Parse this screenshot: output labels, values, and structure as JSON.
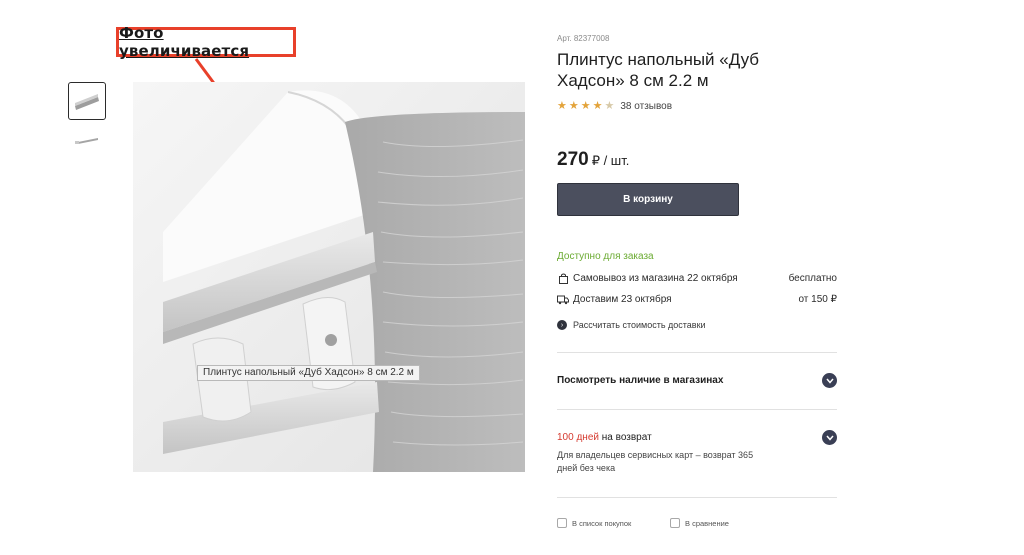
{
  "annotation": {
    "label": "Фото увеличивается",
    "color": "#e8402a"
  },
  "gallery": {
    "tooltip": "Плинтус напольный «Дуб Хадсон» 8 см 2.2 м"
  },
  "product": {
    "sku": "Арт. 82377008",
    "title": "Плинтус напольный «Дуб Хадсон» 8 см 2.2 м",
    "rating_value": 4.5,
    "reviews": "38 отзывов",
    "price": "270",
    "price_unit": "₽ / шт.",
    "cart_button": "В корзину"
  },
  "availability": {
    "status": "Доступно для заказа",
    "pickup": {
      "label": "Самовывоз из магазина 22 октября",
      "value": "бесплатно",
      "icon": "bag-icon"
    },
    "delivery": {
      "label": "Доставим 23 октября",
      "value": "от 150 ₽",
      "icon": "truck-icon"
    },
    "calc_link": "Рассчитать стоимость доставки"
  },
  "accordion": {
    "stores": "Посмотреть наличие в магазинах",
    "return_days": "100 дней",
    "return_rest": "на возврат",
    "return_desc": "Для владельцев сервисных карт – возврат 365 дней без чека"
  },
  "actions": {
    "shopping_list": "В список покупок",
    "compare": "В сравнение"
  },
  "colors": {
    "accent": "#4b4f5e",
    "available": "#6bab32",
    "star": "#e3a33a",
    "return": "#d53a2f"
  }
}
